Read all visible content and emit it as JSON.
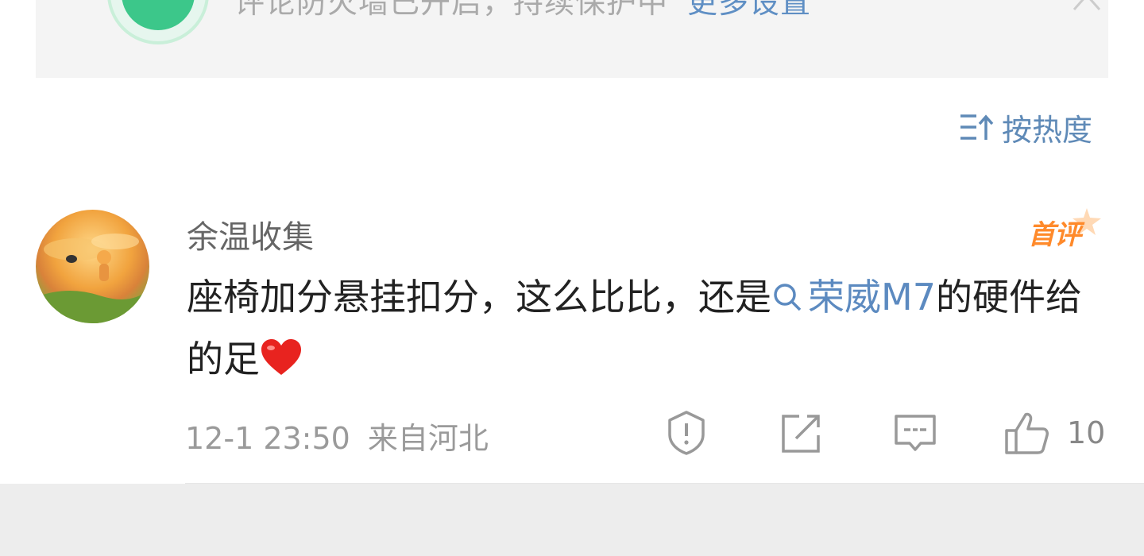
{
  "banner": {
    "message": "评论防火墙已开启，持续保护中",
    "link_label": "更多设置",
    "close_icon": "close-icon",
    "shield_icon": "shield-bolt-icon"
  },
  "sort": {
    "label": "按热度",
    "icon": "sort-icon"
  },
  "comment": {
    "username": "余温收集",
    "badge": "首评",
    "text_before": "座椅加分悬挂扣分，这么比比，还是",
    "topic": "荣威M7",
    "text_after": "的硬件给的足",
    "emoji": "heart-icon",
    "time": "12-1 23:50",
    "location": "来自河北",
    "like_count": "10"
  },
  "actions": [
    "report-icon",
    "share-icon",
    "reply-icon",
    "like-icon"
  ],
  "colors": {
    "link": "#5c8ac0",
    "badge": "#ff8a2b",
    "text": "#222222",
    "meta": "#9a9a9a",
    "banner_bg": "#f4f4f4"
  }
}
